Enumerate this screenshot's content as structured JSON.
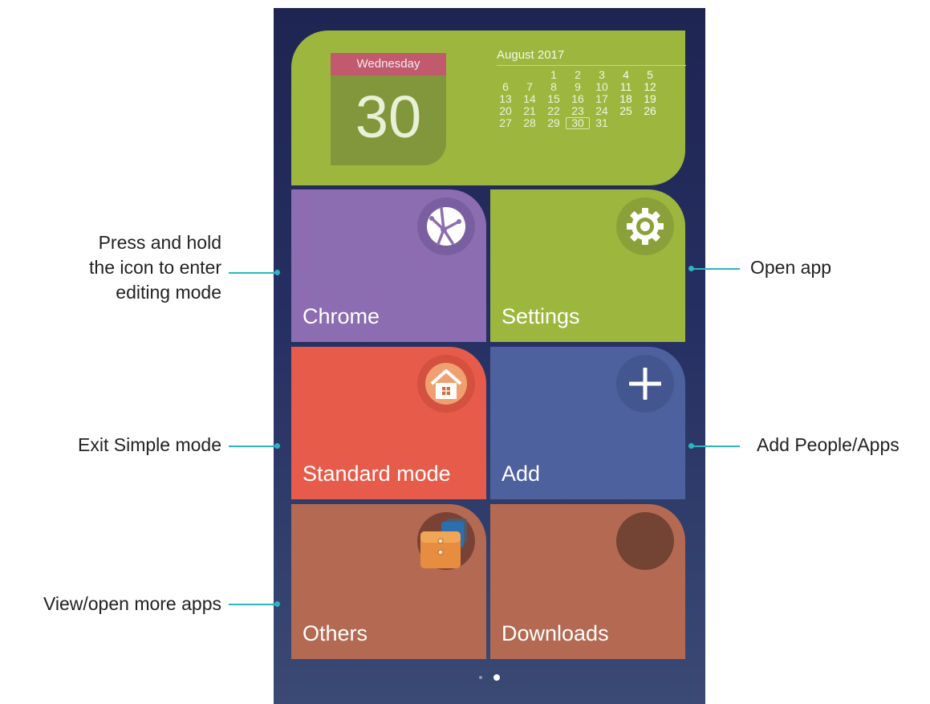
{
  "calendar": {
    "weekday": "Wednesday",
    "day": "30",
    "month_title": "August 2017",
    "weeks": [
      [
        "",
        "",
        "1",
        "2",
        "3",
        "4",
        "5"
      ],
      [
        "6",
        "7",
        "8",
        "9",
        "10",
        "11",
        "12"
      ],
      [
        "13",
        "14",
        "15",
        "16",
        "17",
        "18",
        "19"
      ],
      [
        "20",
        "21",
        "22",
        "23",
        "24",
        "25",
        "26"
      ],
      [
        "27",
        "28",
        "29",
        "30",
        "31",
        "",
        ""
      ]
    ],
    "today": "30"
  },
  "tiles": {
    "chrome": {
      "label": "Chrome",
      "icon": "globe-icon"
    },
    "settings": {
      "label": "Settings",
      "icon": "gear-icon"
    },
    "standard": {
      "label": "Standard mode",
      "icon": "home-icon"
    },
    "add": {
      "label": "Add",
      "icon": "plus-icon"
    },
    "others": {
      "label": "Others",
      "icon": "folder-stack-icon"
    },
    "downloads": {
      "label": "Downloads",
      "icon": "download-circle-icon"
    }
  },
  "page_indicator": {
    "pages": 2,
    "current": 2
  },
  "callouts": {
    "press_hold": [
      "Press and hold",
      "the icon to enter",
      "editing mode"
    ],
    "exit_simple": "Exit Simple mode",
    "view_more": "View/open more apps",
    "open_app": "Open app",
    "add_people": "Add People/Apps"
  },
  "colors": {
    "calendar": "#9db63e",
    "chrome": "#8c6db1",
    "settings": "#9db63e",
    "standard": "#e75b4a",
    "add": "#4e619f",
    "others": "#b46a52",
    "downloads": "#b46a52",
    "callout_line": "#2bb5c0"
  }
}
